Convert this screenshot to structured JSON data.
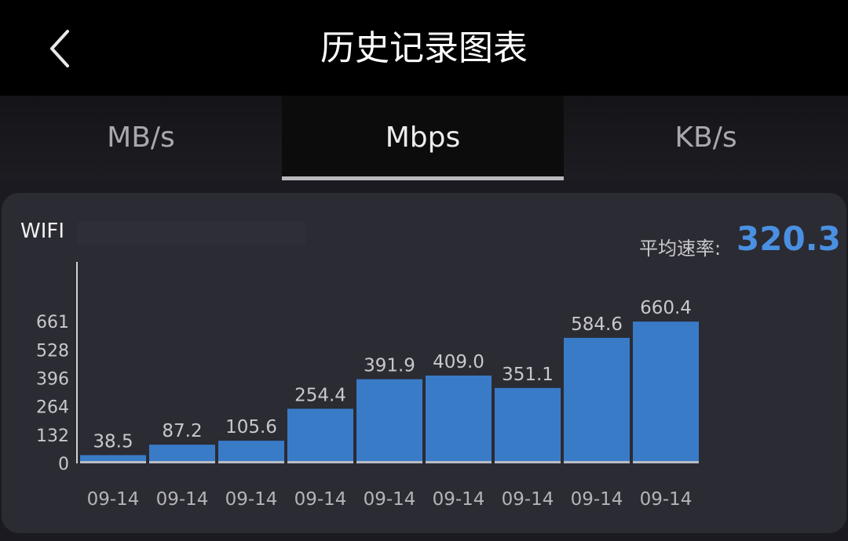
{
  "header": {
    "title": "历史记录图表",
    "back_icon": "chevron-left-icon"
  },
  "tabs": [
    {
      "label": "MB/s",
      "active": false
    },
    {
      "label": "Mbps",
      "active": true
    },
    {
      "label": "KB/s",
      "active": false
    }
  ],
  "card": {
    "network_label": "WIFI",
    "average_label": "平均速率:",
    "average_value": "320.3"
  },
  "colors": {
    "accent": "#4a90e2",
    "bar": "#3a7bc8",
    "background": "#000000",
    "card": "#2b2b33"
  },
  "chart_data": {
    "type": "bar",
    "categories": [
      "09-14",
      "09-14",
      "09-14",
      "09-14",
      "09-14",
      "09-14",
      "09-14",
      "09-14",
      "09-14"
    ],
    "values": [
      38.5,
      87.2,
      105.6,
      254.4,
      391.9,
      409.0,
      351.1,
      584.6,
      660.4
    ],
    "value_labels": [
      "38.5",
      "87.2",
      "105.6",
      "254.4",
      "391.9",
      "409.0",
      "351.1",
      "584.6",
      "660.4"
    ],
    "yticks": [
      "0",
      "132",
      "264",
      "396",
      "528",
      "661"
    ],
    "ytick_values": [
      0,
      132,
      264,
      396,
      528,
      661
    ],
    "ylim": [
      0,
      661
    ],
    "grid": false
  }
}
